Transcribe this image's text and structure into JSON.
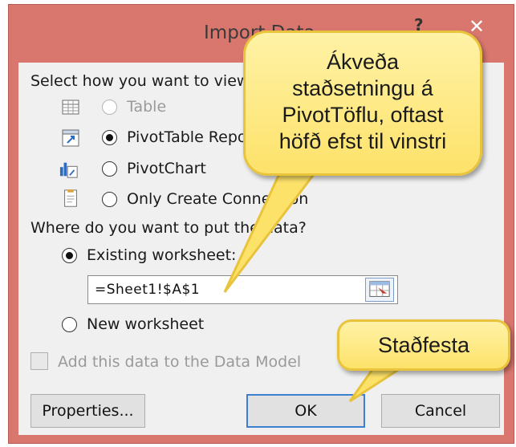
{
  "window": {
    "title": "Import Data",
    "help_glyph": "?",
    "close_glyph": "✕"
  },
  "view_section": {
    "prompt": "Select how you want to view this data in your workbook.",
    "options": [
      {
        "label": "Table",
        "checked": false,
        "disabled": true,
        "icon": "table-icon"
      },
      {
        "label": "PivotTable Report",
        "checked": true,
        "disabled": false,
        "icon": "pivottable-icon"
      },
      {
        "label": "PivotChart",
        "checked": false,
        "disabled": false,
        "icon": "pivotchart-icon"
      },
      {
        "label": "Only Create Connection",
        "checked": false,
        "disabled": false,
        "icon": "connection-icon"
      }
    ]
  },
  "location_section": {
    "prompt": "Where do you want to put the data?",
    "existing_label": "Existing worksheet:",
    "existing_checked": true,
    "cell_reference": "=Sheet1!$A$1",
    "new_label": "New worksheet",
    "new_checked": false
  },
  "data_model": {
    "label": "Add this data to the Data Model",
    "checked": false,
    "disabled": true
  },
  "buttons": {
    "properties": "Properties...",
    "ok": "OK",
    "cancel": "Cancel"
  },
  "callouts": {
    "location_note": "Ákveða staðsetningu á PivotTöflu, oftast höfð efst til vinstri",
    "location_lines": [
      "Ákveða",
      "staðsetningu á",
      "PivotTöflu, oftast",
      "höfð efst til vinstri"
    ],
    "confirm_note": "Staðfesta"
  },
  "colors": {
    "title_bar": "#d9776f",
    "dialog_bg": "#f0f0f0",
    "callout_fill": "#fde26a",
    "callout_border": "#e8c33b",
    "ok_border": "#3c7fd0"
  }
}
